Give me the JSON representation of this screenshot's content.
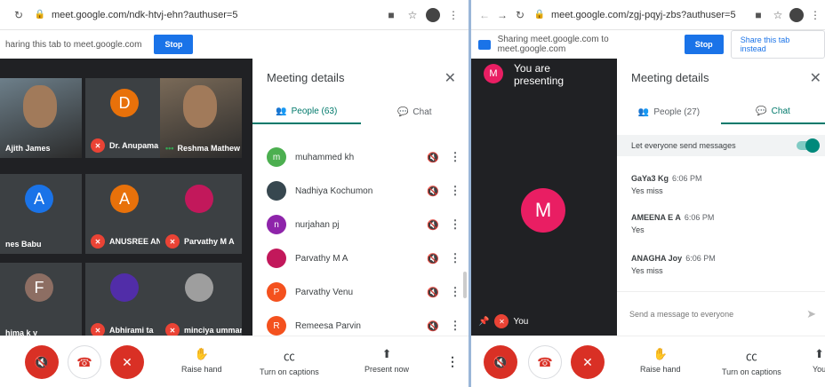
{
  "left": {
    "url": "meet.google.com/ndk-htvj-ehn?authuser=5",
    "share_text": "haring this tab to meet.google.com",
    "stop_label": "Stop",
    "tiles": [
      {
        "name": "Ajith James",
        "photo": true,
        "color": "#6d7f8a"
      },
      {
        "name": "Dr. Anupama P",
        "letter": "D",
        "color": "#e8710a"
      },
      {
        "name": "Reshma Mathew",
        "photo": true,
        "color": "#7a6a58"
      },
      {
        "name": "nes Babu",
        "letter": "A",
        "color": "#1a73e8"
      },
      {
        "name": "ANUSREE ANIL",
        "letter": "A",
        "color": "#e8710a"
      },
      {
        "name": "Parvathy M A",
        "letter": "",
        "color": "#c2185b"
      },
      {
        "name": "hima k y",
        "letter": "F",
        "color": "#8d6e63"
      },
      {
        "name": "Abhirami ta",
        "letter": "",
        "color": "#512da8"
      },
      {
        "name": "minciya ummar",
        "letter": "",
        "color": "#9e9e9e"
      }
    ],
    "panel": {
      "title": "Meeting details",
      "tab_people": "People (63)",
      "tab_chat": "Chat",
      "participants": [
        {
          "name": "muhammed kh",
          "letter": "m",
          "color": "#4caf50"
        },
        {
          "name": "Nadhiya Kochumon",
          "letter": "",
          "color": "#37474f"
        },
        {
          "name": "nurjahan pj",
          "letter": "n",
          "color": "#8e24aa"
        },
        {
          "name": "Parvathy M A",
          "letter": "",
          "color": "#c2185b"
        },
        {
          "name": "Parvathy Venu",
          "letter": "P",
          "color": "#f4511e"
        },
        {
          "name": "Remeesa Parvin",
          "letter": "R",
          "color": "#f4511e"
        }
      ]
    },
    "bottom": {
      "raise_hand": "Raise hand",
      "captions": "Turn on captions",
      "present": "Present now"
    }
  },
  "right": {
    "url": "meet.google.com/zgj-pqyj-zbs?authuser=5",
    "share_text": "Sharing meet.google.com to meet.google.com",
    "stop_label": "Stop",
    "share_instead": "Share this tab instead",
    "presenting_letter": "M",
    "presenting_text": "You are presenting",
    "big_letter": "M",
    "self_label": "You",
    "panel": {
      "title": "Meeting details",
      "tab_people": "People (27)",
      "tab_chat": "Chat",
      "toggle_label": "Let everyone send messages",
      "messages": [
        {
          "who": "GaYa3 Kg",
          "time": "6:06 PM",
          "text": "Yes miss"
        },
        {
          "who": "AMEENA E A",
          "time": "6:06 PM",
          "text": "Yes"
        },
        {
          "who": "ANAGHA Joy",
          "time": "6:06 PM",
          "text": "Yes miss"
        }
      ],
      "input_placeholder": "Send a message to everyone"
    },
    "bottom": {
      "raise_hand": "Raise hand",
      "captions": "Turn on captions",
      "cut": "You"
    }
  },
  "colors": {
    "accent": "#1a73e8",
    "teal": "#00796b",
    "red": "#d93025"
  }
}
